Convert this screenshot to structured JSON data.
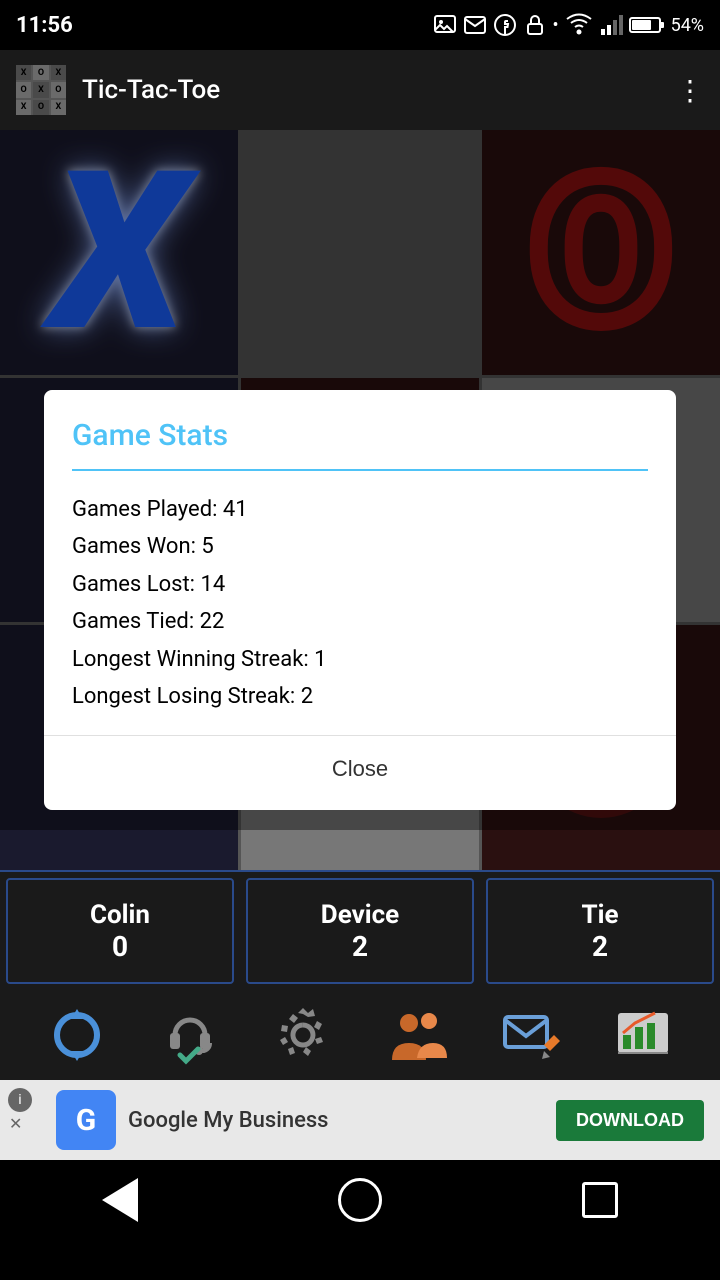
{
  "statusBar": {
    "time": "11:56",
    "battery": "54%"
  },
  "appBar": {
    "title": "Tic-Tac-Toe"
  },
  "dialog": {
    "title": "Game Stats",
    "stats": [
      "Games Played: 41",
      "Games Won: 5",
      "Games Lost: 14",
      "Games Tied: 22",
      "Longest Winning Streak: 1",
      "Longest Losing Streak: 2"
    ],
    "closeLabel": "Close"
  },
  "scores": [
    {
      "name": "Colin",
      "value": "0"
    },
    {
      "name": "Device",
      "value": "2"
    },
    {
      "name": "Tie",
      "value": "2"
    }
  ],
  "ad": {
    "appName": "Google My Business",
    "downloadLabel": "DOWNLOAD",
    "logoLetter": "G"
  }
}
